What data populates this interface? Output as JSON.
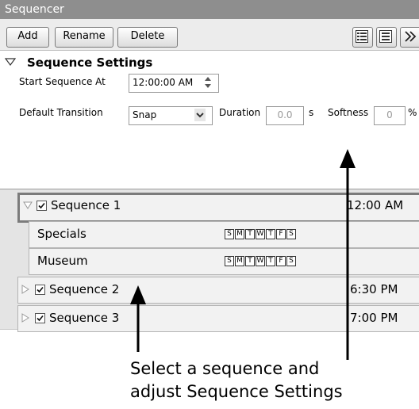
{
  "window": {
    "title": "Sequencer"
  },
  "toolbar": {
    "add_label": "Add",
    "rename_label": "Rename",
    "delete_label": "Delete",
    "icons": [
      "list-view-icon",
      "detail-view-icon",
      "more-icon"
    ]
  },
  "settings": {
    "section_title": "Sequence Settings",
    "start_label": "Start Sequence At",
    "start_value": "12:00:00 AM",
    "transition_label": "Default Transition",
    "transition_value": "Snap",
    "duration_label": "Duration",
    "duration_value": "0.0",
    "duration_unit": "s",
    "softness_label": "Softness",
    "softness_value": "0",
    "softness_unit": "%"
  },
  "sequences": [
    {
      "name": "Sequence 1",
      "time": "12:00 AM",
      "checked": true,
      "expanded": true,
      "items": [
        {
          "name": "Specials",
          "days": [
            "S",
            "M",
            "T",
            "W",
            "T",
            "F",
            "S"
          ]
        },
        {
          "name": "Museum",
          "days": [
            "S",
            "M",
            "T",
            "W",
            "T",
            "F",
            "S"
          ]
        }
      ]
    },
    {
      "name": "Sequence 2",
      "time": "6:30 PM",
      "checked": true,
      "expanded": false
    },
    {
      "name": "Sequence 3",
      "time": "7:00 PM",
      "checked": true,
      "expanded": false
    }
  ],
  "annotation": {
    "line1": "Select a sequence and",
    "line2": "adjust Sequence Settings"
  }
}
